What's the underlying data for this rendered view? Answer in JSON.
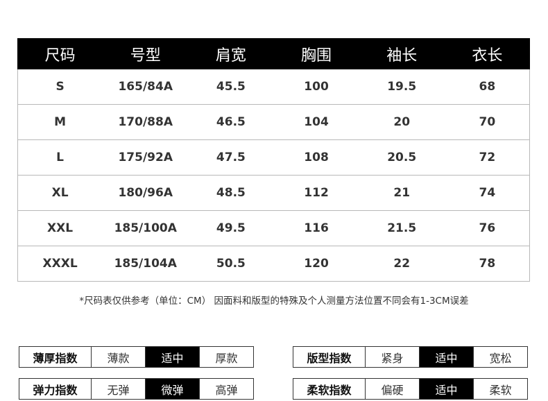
{
  "table": {
    "headers": [
      "尺码",
      "号型",
      "肩宽",
      "胸围",
      "袖长",
      "衣长"
    ],
    "rows": [
      [
        "S",
        "165/84A",
        "45.5",
        "100",
        "19.5",
        "68"
      ],
      [
        "M",
        "170/88A",
        "46.5",
        "104",
        "20",
        "70"
      ],
      [
        "L",
        "175/92A",
        "47.5",
        "108",
        "20.5",
        "72"
      ],
      [
        "XL",
        "180/96A",
        "48.5",
        "112",
        "21",
        "74"
      ],
      [
        "XXL",
        "185/100A",
        "49.5",
        "116",
        "21.5",
        "76"
      ],
      [
        "XXXL",
        "185/104A",
        "50.5",
        "120",
        "22",
        "78"
      ]
    ]
  },
  "note": "*尺码表仅供参考（单位：CM） 因面料和版型的特殊及个人测量方法位置不同会有1-3CM误差",
  "indices": [
    {
      "label": "薄厚指数",
      "options": [
        "薄款",
        "适中",
        "厚款"
      ],
      "selected": "适中"
    },
    {
      "label": "版型指数",
      "options": [
        "紧身",
        "适中",
        "宽松"
      ],
      "selected": "适中"
    },
    {
      "label": "弹力指数",
      "options": [
        "无弹",
        "微弹",
        "高弹"
      ],
      "selected": "微弹"
    },
    {
      "label": "柔软指数",
      "options": [
        "偏硬",
        "适中",
        "柔软"
      ],
      "selected": "适中"
    }
  ],
  "colors": {
    "header_bg": "#000000",
    "active_bg": "#000000",
    "border": "#b8b8b8"
  }
}
